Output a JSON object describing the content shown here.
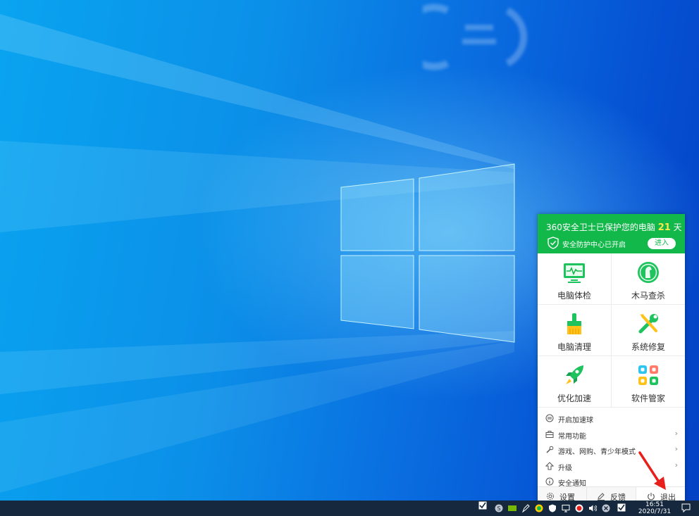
{
  "panel": {
    "title_prefix": "360安全卫士已保护您的电脑",
    "days": "21",
    "title_suffix": "天",
    "status": "安全防护中心已开启",
    "enter_label": "进入",
    "tiles": [
      {
        "label": "电脑体检",
        "icon": "monitor-icon"
      },
      {
        "label": "木马查杀",
        "icon": "horse-shield-icon"
      },
      {
        "label": "电脑清理",
        "icon": "broom-icon"
      },
      {
        "label": "系统修复",
        "icon": "wrench-screwdriver-icon"
      },
      {
        "label": "优化加速",
        "icon": "rocket-icon"
      },
      {
        "label": "软件管家",
        "icon": "apps-grid-icon"
      }
    ],
    "menu": [
      {
        "label": "开启加速球",
        "icon": "speed-ball-icon",
        "arrow": ""
      },
      {
        "label": "常用功能",
        "icon": "toolbox-icon",
        "arrow": "›"
      },
      {
        "label": "游戏、网购、青少年模式",
        "icon": "wrench-icon",
        "arrow": "›"
      },
      {
        "label": "升级",
        "icon": "upgrade-arrow-icon",
        "arrow": "›"
      },
      {
        "label": "安全通知",
        "icon": "info-icon",
        "arrow": ""
      }
    ],
    "footer": {
      "settings": "设置",
      "feedback": "反馈",
      "exit": "退出"
    }
  },
  "taskbar": {
    "time": "16:51",
    "date": "2020/7/31"
  },
  "colors": {
    "brand_green": "#13b84b",
    "days_yellow": "#ffe94a",
    "annotation_red": "#e8201c",
    "taskbar": "#15283e"
  }
}
